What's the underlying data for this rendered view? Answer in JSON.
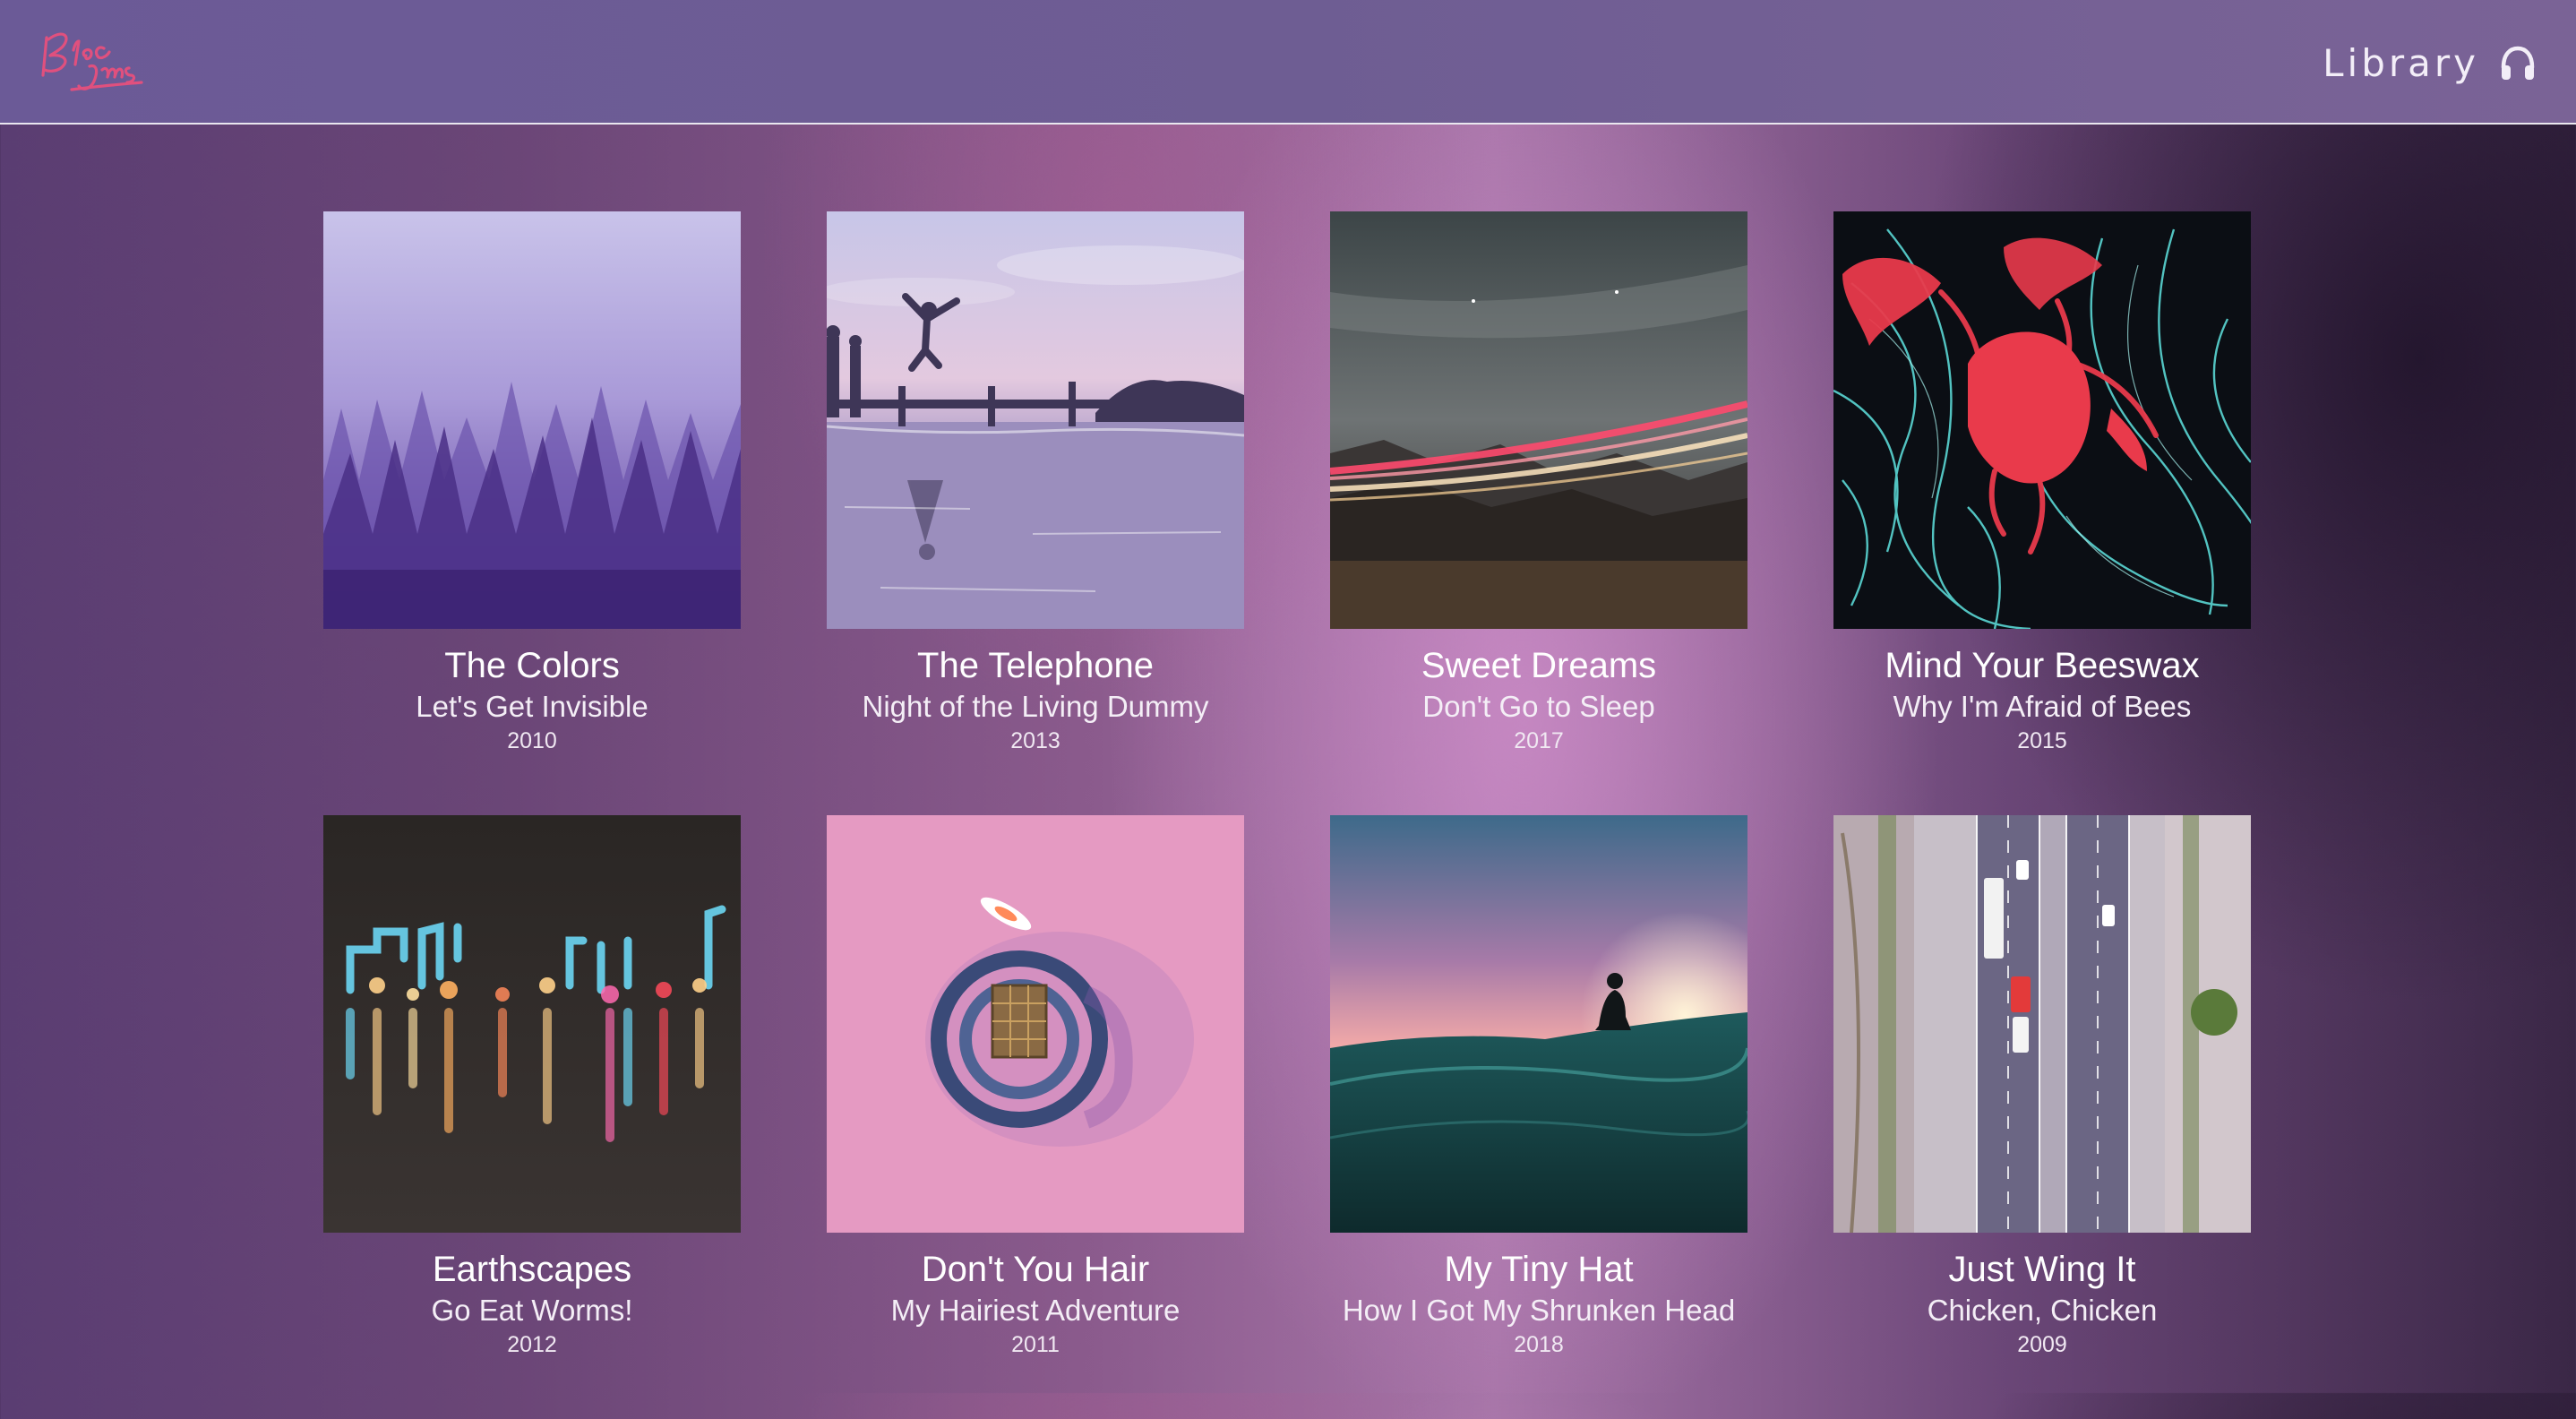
{
  "header": {
    "logo_icon": "script-logo",
    "library_label": "Library",
    "library_icon": "headphones-icon"
  },
  "albums": [
    {
      "title": "The Colors",
      "subtitle": "Let's Get Invisible",
      "year": "2010",
      "cover": "misty-purple-forest"
    },
    {
      "title": "The Telephone",
      "subtitle": "Night of the Living Dummy",
      "year": "2013",
      "cover": "dock-jump-sunset-lake"
    },
    {
      "title": "Sweet Dreams",
      "subtitle": "Don't Go to Sleep",
      "year": "2017",
      "cover": "light-trails-mountains"
    },
    {
      "title": "Mind Your Beeswax",
      "subtitle": "Why I'm Afraid of Bees",
      "year": "2015",
      "cover": "red-ink-cyan-strands"
    },
    {
      "title": "Earthscapes",
      "subtitle": "Go Eat Worms!",
      "year": "2012",
      "cover": "city-lights-bokeh"
    },
    {
      "title": "Don't You Hair",
      "subtitle": "My Hairiest Adventure",
      "year": "2011",
      "cover": "pink-water-boats-aerial"
    },
    {
      "title": "My Tiny Hat",
      "subtitle": "How I Got My Shrunken Head",
      "year": "2018",
      "cover": "surfer-sunset-wave"
    },
    {
      "title": "Just Wing It",
      "subtitle": "Chicken, Chicken",
      "year": "2009",
      "cover": "highway-aerial"
    }
  ],
  "colors": {
    "header_bg": "#6b5a97",
    "logo_pink": "#e0507e",
    "text": "#ffffff"
  }
}
